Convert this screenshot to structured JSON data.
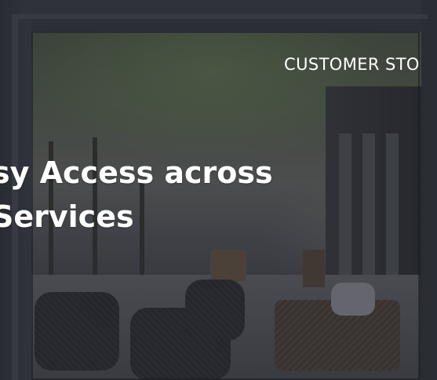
{
  "nav": {
    "customer_stories": "CUSTOMER STO"
  },
  "hero": {
    "headline_line1": "sy Access across",
    "headline_line2": "Services",
    "background_image": "outdoor-terrace-photo"
  },
  "colors": {
    "text": "#ffffff",
    "overlay": "#1c1e26"
  }
}
